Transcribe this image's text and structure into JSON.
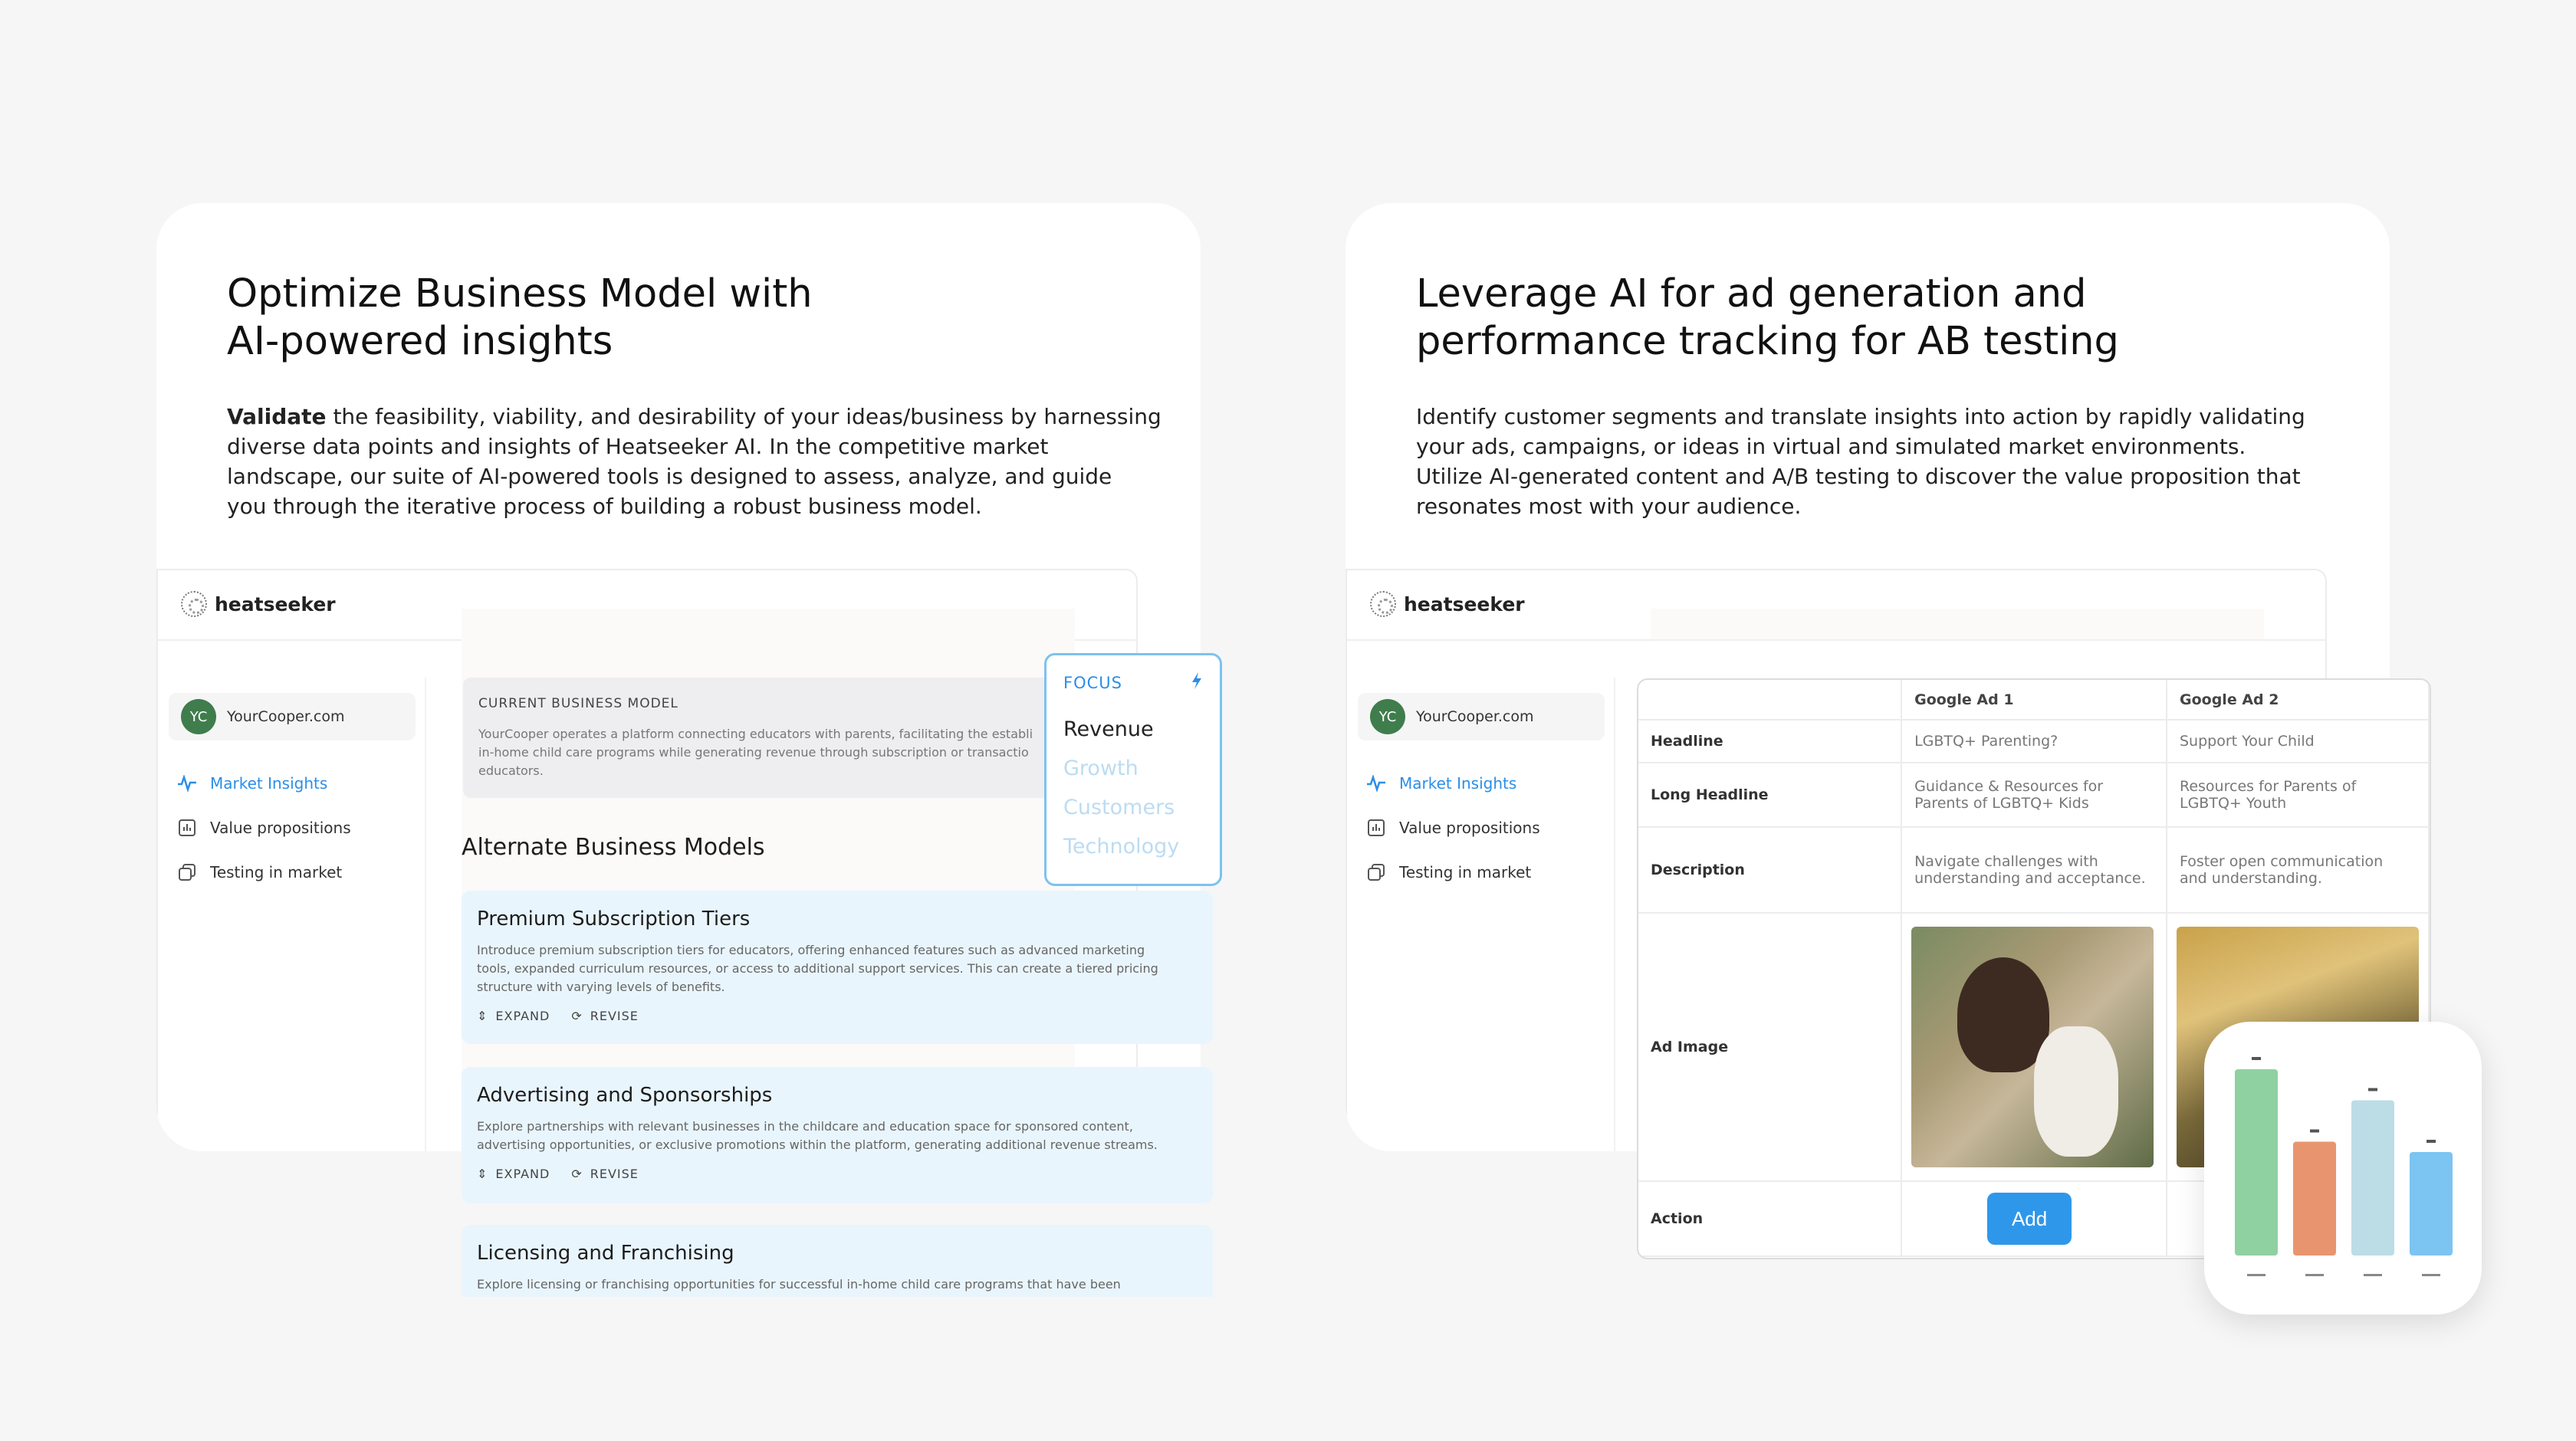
{
  "left": {
    "headline": [
      "Optimize Business Model with",
      "AI-powered insights"
    ],
    "para_bold": "Validate",
    "para_lines": [
      " the feasibility, viability, and desirability of your ideas/business by harnessing",
      "diverse  data points and insights of Heatseeker AI. In the competitive market",
      "landscape,  our suite of AI-powered tools is designed to assess, analyze, and guide",
      "you through the  iterative process of building a robust business model."
    ],
    "app": {
      "logo": "heatseeker",
      "avatar": "YC",
      "company": "YourCooper.com",
      "nav": [
        "Market Insights",
        "Value propositions",
        "Testing in market"
      ],
      "current_title": "CURRENT BUSINESS MODEL",
      "current_lines": [
        "YourCooper operates a platform connecting educators with parents, facilitating the establi",
        "in-home child care programs while generating revenue through subscription or transactio",
        "educators."
      ],
      "alt_title": "Alternate Business Models",
      "cards": [
        {
          "title": "Premium Subscription Tiers",
          "desc": [
            "Introduce premium subscription tiers for educators, offering enhanced features such as advanced marketing",
            "tools, expanded curriculum resources, or access to additional support services. This can create a tiered pricing",
            "structure with varying levels of benefits."
          ],
          "expand": "EXPAND",
          "revise": "REVISE"
        },
        {
          "title": "Advertising and Sponsorships",
          "desc": [
            "Explore partnerships with relevant businesses in the childcare and education space for sponsored content,",
            "advertising opportunities, or exclusive promotions within the platform, generating additional revenue streams."
          ],
          "expand": "EXPAND",
          "revise": "REVISE"
        },
        {
          "title": "Licensing and Franchising",
          "desc": [
            "Explore licensing or franchising opportunities for successful in-home child care programs that have been"
          ]
        }
      ],
      "focus": {
        "label": "FOCUS",
        "items": [
          "Revenue",
          "Growth",
          "Customers",
          "Technology"
        ]
      }
    }
  },
  "right": {
    "headline": [
      "Leverage AI for ad generation and",
      "performance tracking for AB testing"
    ],
    "para_lines": [
      "Identify customer segments and translate insights into action by rapidly validating",
      "your ads, campaigns, or ideas in virtual and simulated market environments.",
      "Utilize AI-generated content and A/B testing to discover the value proposition that",
      "resonates most with your audience."
    ],
    "app": {
      "logo": "heatseeker",
      "avatar": "YC",
      "company": "YourCooper.com",
      "nav": [
        "Market Insights",
        "Value propositions",
        "Testing in market"
      ]
    },
    "table": {
      "columns": [
        "",
        "Google Ad 1",
        "Google Ad 2"
      ],
      "rows": {
        "headline": [
          "Headline",
          "LGBTQ+ Parenting?",
          "Support Your Child"
        ],
        "long": [
          "Long Headline",
          [
            "Guidance & Resources for",
            "Parents of LGBTQ+ Kids"
          ],
          [
            "Resources for Parents of",
            "LGBTQ+ Youth"
          ]
        ],
        "desc": [
          "Description",
          [
            "Navigate challenges with",
            "understanding and acceptance."
          ],
          [
            "Foster open communication",
            "and understanding."
          ]
        ],
        "image": "Ad Image",
        "action": "Action",
        "add": "Add"
      }
    }
  },
  "colors": {
    "accent": "#2b8ee8",
    "card_bg": "#e9f5fd",
    "bars": [
      "#8fd1a0",
      "#e8956f",
      "#bcdde6",
      "#7cc4f2"
    ]
  },
  "mini_chart": {
    "values": [
      0.9,
      0.55,
      0.75,
      0.5
    ]
  }
}
